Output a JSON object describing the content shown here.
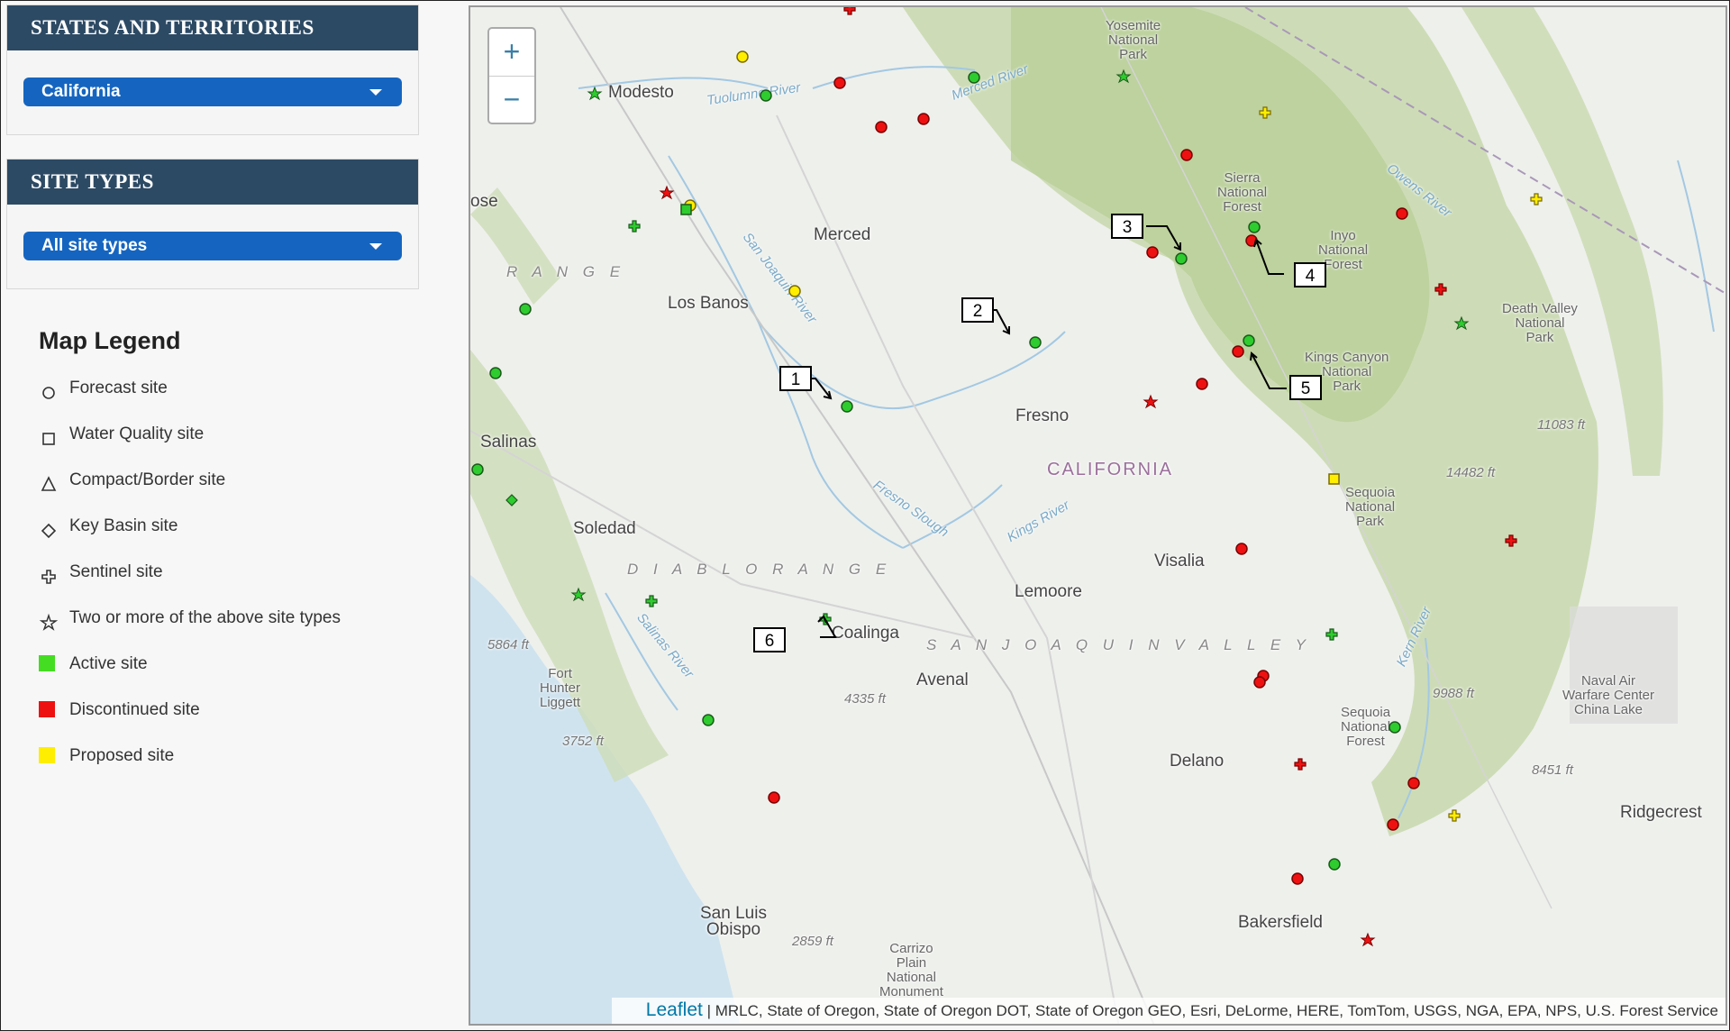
{
  "states_panel": {
    "title": "STATES AND TERRITORIES",
    "selected": "California"
  },
  "types_panel": {
    "title": "SITE TYPES",
    "selected": "All site types"
  },
  "legend": {
    "title": "Map Legend",
    "items": [
      {
        "label": "Forecast site",
        "icon": "circle-outline-icon"
      },
      {
        "label": "Water Quality site",
        "icon": "square-outline-icon"
      },
      {
        "label": "Compact/Border site",
        "icon": "triangle-outline-icon"
      },
      {
        "label": "Key Basin site",
        "icon": "diamond-outline-icon"
      },
      {
        "label": "Sentinel site",
        "icon": "plus-outline-icon"
      },
      {
        "label": "Two or more of the above site types",
        "icon": "star-outline-icon"
      },
      {
        "label": "Active site",
        "color": "#44dd22"
      },
      {
        "label": "Discontinued site",
        "color": "#ee1111"
      },
      {
        "label": "Proposed site",
        "color": "#ffee00"
      }
    ]
  },
  "map": {
    "zoom_in": "+",
    "zoom_out": "−",
    "attribution_brand": "Leaflet",
    "attribution_text": "| MRLC, State of Oregon, State of Oregon DOT, State of Oregon GEO, Esri, DeLorme, HERE, TomTom, USGS, NGA, EPA, NPS, U.S. Forest Service",
    "places": {
      "modesto": "Modesto",
      "merced": "Merced",
      "los_banos": "Los Banos",
      "salinas": "Salinas",
      "soledad": "Soledad",
      "fresno": "Fresno",
      "california": "CALIFORNIA",
      "visalia": "Visalia",
      "lemoore": "Lemoore",
      "coalinga": "Coalinga",
      "avenal": "Avenal",
      "delano": "Delano",
      "bakersfield": "Bakersfield",
      "san_luis": "San Luis\nObispo",
      "ridgecrest": "Ridgecrest",
      "ose": "ose",
      "yosemite": "Yosemite\nNational\nPark",
      "sierra_nf": "Sierra\nNational\nForest",
      "inyo_nf": "Inyo\nNational\nForest",
      "kings_canyon": "Kings Canyon\nNational\nPark",
      "sequoia_np": "Sequoia\nNational\nPark",
      "sequoia_nf": "Sequoia\nNational\nForest",
      "death_valley": "Death Valley\nNational\nPark",
      "naval_air": "Naval Air\nWarfare Center\nChina Lake",
      "fort_hunter": "Fort\nHunter\nLiggett",
      "carrizo": "Carrizo\nPlain\nNational\nMonument",
      "range": "R A N G E",
      "diablo": "D I A B L O   R A N G E",
      "sj_valley": "S A N   J O A Q U I N   V A L L E Y",
      "tuolumne": "Tuolumne River",
      "merced_r": "Merced River",
      "san_joaquin": "San Joaquin River",
      "fresno_slough": "Fresno Slough",
      "kings_river": "Kings River",
      "salinas_r": "Salinas River",
      "owens_r": "Owens River",
      "kern_r": "Kern River",
      "e1": "11083 ft",
      "e2": "14482 ft",
      "e3": "5864 ft",
      "e4": "4335 ft",
      "e5": "3752 ft",
      "e6": "9988 ft",
      "e7": "8451 ft",
      "e8": "2859 ft"
    },
    "callouts": [
      "1",
      "2",
      "3",
      "4",
      "5",
      "6"
    ]
  }
}
